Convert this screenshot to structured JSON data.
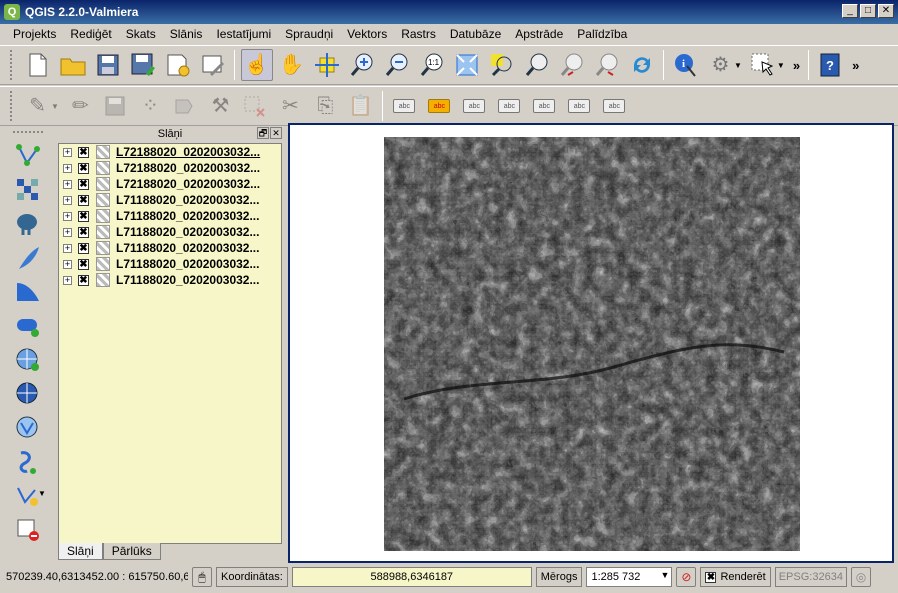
{
  "window": {
    "title": "QGIS 2.2.0-Valmiera",
    "app_icon": "Q",
    "minimize": "_",
    "maximize": "□",
    "close": "✕"
  },
  "menu": [
    "Projekts",
    "Rediģēt",
    "Skats",
    "Slānis",
    "Iestatījumi",
    "Spraudņi",
    "Vektors",
    "Rastrs",
    "Datubāze",
    "Apstrāde",
    "Palīdzība"
  ],
  "toolbar_more": "»",
  "layers_panel": {
    "title": "Slāņi",
    "float_btn": "🗗",
    "close_btn": "✕",
    "expand_glyph": "+",
    "checked_glyph": "✖",
    "layers": [
      "L72188020_0202003032...",
      "L72188020_0202003032...",
      "L72188020_0202003032...",
      "L71188020_0202003032...",
      "L71188020_0202003032...",
      "L71188020_0202003032...",
      "L71188020_0202003032...",
      "L71188020_0202003032...",
      "L71188020_0202003032..."
    ],
    "tabs": [
      "Slāņi",
      "Pārlūks"
    ]
  },
  "statusbar": {
    "extent_text": "570239.40,6313452.00 : 615750.60,6",
    "coord_label": "Koordinātas:",
    "coord_value": "588988,6346187",
    "scale_label": "Mērogs",
    "scale_value": "1:285 732",
    "render_label": "Renderēt",
    "render_checked": "✖",
    "crs": "EPSG:32634"
  },
  "label_tool_text": "abc",
  "colors": {
    "titlebar": "#0a246a",
    "layer_panel_bg": "#f7f6c9",
    "canvas_border": "#0a246a"
  }
}
